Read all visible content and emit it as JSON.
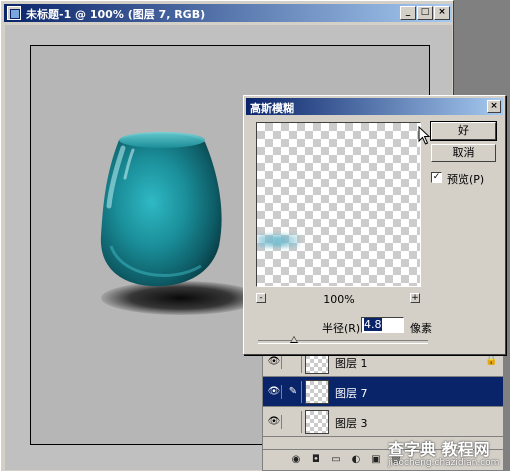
{
  "document": {
    "title": "未标题-1 @ 100% (图层 7, RGB)",
    "buttons": {
      "minimize": "_",
      "maximize": "□",
      "close": "×"
    }
  },
  "dialog": {
    "title": "高斯模糊",
    "close": "×",
    "ok_label": "好",
    "cancel_label": "取消",
    "preview_label": "预览(P)",
    "preview_checked": true,
    "zoom_label": "100%",
    "zoom_out": "-",
    "zoom_in": "+",
    "radius_label": "半径(R):",
    "radius_value": "4.8",
    "radius_unit": "像素"
  },
  "layers": {
    "rows": [
      {
        "name": "图层 1",
        "visible": true,
        "locked": true,
        "selected": false
      },
      {
        "name": "图层 7",
        "visible": true,
        "locked": false,
        "selected": true
      },
      {
        "name": "图层 3",
        "visible": true,
        "locked": false,
        "selected": false
      }
    ],
    "tools": [
      "brush-icon",
      "mask-icon",
      "new-set-icon",
      "adjustment-icon",
      "new-layer-icon",
      "trash-icon"
    ]
  },
  "watermark": {
    "main": "查字典 教程网",
    "sub": "jiaocheng.chazidian.com"
  },
  "colors": {
    "title_gradient_start": "#0a246a",
    "title_gradient_end": "#a6caf0",
    "vase_color": "#1e8c96",
    "selection": "#0a246a"
  }
}
